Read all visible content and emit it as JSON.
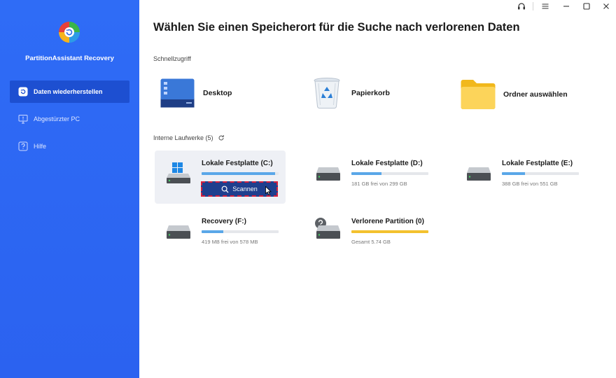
{
  "app": {
    "name": "PartitionAssistant Recovery"
  },
  "sidebar": {
    "items": [
      {
        "label": "Daten wiederherstellen",
        "icon": "restore-icon",
        "active": true
      },
      {
        "label": "Abgestürzter PC",
        "icon": "monitor-icon",
        "active": false
      },
      {
        "label": "Hilfe",
        "icon": "help-icon",
        "active": false
      }
    ]
  },
  "window_controls": [
    "headset-icon",
    "menu-icon",
    "minimize-icon",
    "maximize-icon",
    "close-icon"
  ],
  "main": {
    "title": "Wählen Sie einen Speicherort für die Suche nach verlorenen Daten",
    "quick_access": {
      "label": "Schnellzugriff",
      "items": [
        {
          "label": "Desktop",
          "icon": "desktop-icon"
        },
        {
          "label": "Papierkorb",
          "icon": "recycle-bin-icon"
        },
        {
          "label": "Ordner auswählen",
          "icon": "folder-icon"
        }
      ]
    },
    "drives_section": {
      "label": "Interne Laufwerke (5)",
      "refresh_icon": "refresh-icon"
    },
    "drives": [
      {
        "name": "Lokale Festplatte (C:)",
        "info": "",
        "used_fraction": 0.95,
        "bar_color": "#5aa7e8",
        "selected": true,
        "windows_logo": true
      },
      {
        "name": "Lokale Festplatte (D:)",
        "info": "181 GB frei von 299 GB",
        "used_fraction": 0.39,
        "bar_color": "#5aa7e8",
        "selected": false
      },
      {
        "name": "Lokale Festplatte (E:)",
        "info": "388 GB frei von 551 GB",
        "used_fraction": 0.3,
        "bar_color": "#5aa7e8",
        "selected": false
      },
      {
        "name": "Recovery (F:)",
        "info": "419 MB frei von 578 MB",
        "used_fraction": 0.28,
        "bar_color": "#5aa7e8",
        "selected": false
      },
      {
        "name": "Verlorene Partition (0)",
        "info": "Gesamt 5.74 GB",
        "used_fraction": 1.0,
        "bar_color": "#f3c12e",
        "selected": false,
        "question_badge": true
      }
    ],
    "scan_button": {
      "label": "Scannen",
      "icon": "search-icon"
    }
  }
}
